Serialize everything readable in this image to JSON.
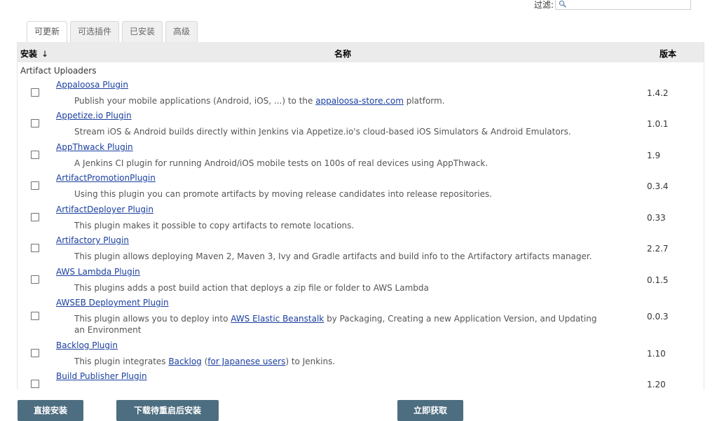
{
  "filter": {
    "label": "过滤:",
    "icon": "search-icon",
    "value": ""
  },
  "tabs": [
    {
      "label": "可更新",
      "active": true
    },
    {
      "label": "可选插件",
      "active": false
    },
    {
      "label": "已安装",
      "active": false
    },
    {
      "label": "高级",
      "active": false
    }
  ],
  "table": {
    "col_install": "安装",
    "sort_arrow": "↓",
    "col_name": "名称",
    "col_version": "版本"
  },
  "category": "Artifact Uploaders",
  "plugins": [
    {
      "name": "Appaloosa Plugin",
      "desc_parts": [
        {
          "t": "Publish your mobile applications (Android, iOS, ...) to the "
        },
        {
          "t": "appaloosa-store.com",
          "link": true
        },
        {
          "t": " platform."
        }
      ],
      "version": "1.4.2"
    },
    {
      "name": "Appetize.io Plugin",
      "desc_parts": [
        {
          "t": "Stream iOS & Android builds directly within Jenkins via Appetize.io's cloud-based iOS Simulators & Android Emulators."
        }
      ],
      "version": "1.0.1"
    },
    {
      "name": "AppThwack Plugin",
      "desc_parts": [
        {
          "t": "A Jenkins CI plugin for running Android/iOS mobile tests on 100s of real devices using AppThwack."
        }
      ],
      "version": "1.9"
    },
    {
      "name": "ArtifactPromotionPlugin",
      "desc_parts": [
        {
          "t": "Using this plugin you can promote artifacts by moving release candidates into release repositories."
        }
      ],
      "version": "0.3.4"
    },
    {
      "name": "ArtifactDeployer Plugin",
      "desc_parts": [
        {
          "t": "This plugin makes it possible to copy artifacts to remote locations."
        }
      ],
      "version": "0.33"
    },
    {
      "name": "Artifactory Plugin",
      "desc_parts": [
        {
          "t": "This plugin allows deploying Maven 2, Maven 3, Ivy and Gradle artifacts and build info to the Artifactory artifacts manager."
        }
      ],
      "version": "2.2.7"
    },
    {
      "name": "AWS Lambda Plugin",
      "desc_parts": [
        {
          "t": "This plugins adds a post build action that deploys a zip file or folder to AWS Lambda"
        }
      ],
      "version": "0.1.5"
    },
    {
      "name": "AWSEB Deployment Plugin",
      "desc_parts": [
        {
          "t": "This plugin allows you to deploy into "
        },
        {
          "t": "AWS Elastic Beanstalk",
          "link": true
        },
        {
          "t": " by Packaging, Creating a new Application Version, and Updating an Environment"
        }
      ],
      "version": "0.0.3"
    },
    {
      "name": "Backlog Plugin",
      "desc_parts": [
        {
          "t": "This plugin integrates "
        },
        {
          "t": "Backlog",
          "link": true
        },
        {
          "t": " ("
        },
        {
          "t": "for Japanese users",
          "link": true
        },
        {
          "t": ") to Jenkins."
        }
      ],
      "version": "1.10"
    },
    {
      "name": "Build Publisher Plugin",
      "desc_parts": [],
      "version": "1.20"
    }
  ],
  "footer": {
    "install_now": "直接安装",
    "download_restart": "下载待重启后安装",
    "check_now": "立即获取"
  }
}
